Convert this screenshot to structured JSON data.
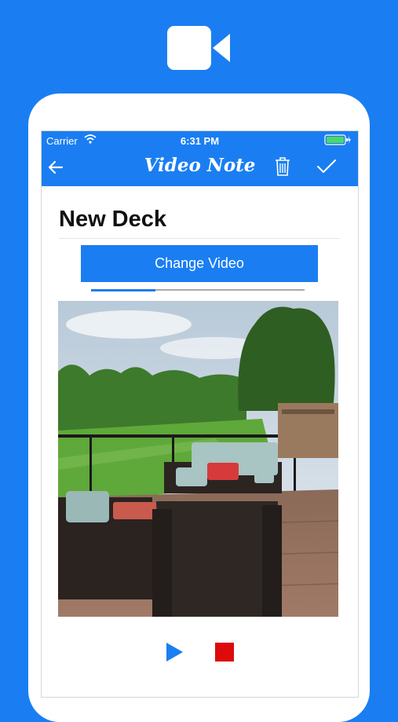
{
  "header": {
    "carrier": "Carrier",
    "time": "6:31 PM",
    "title": "Video Note"
  },
  "note": {
    "title": "New Deck",
    "change_video_label": "Change Video",
    "playback_progress": 0.3
  },
  "colors": {
    "brand_blue": "#1a7ef2",
    "stop_red": "#dd0b0b",
    "battery_green": "#4cd964"
  },
  "icons": {
    "top": "video-camera-icon",
    "back": "back-arrow-icon",
    "delete": "trash-icon",
    "done": "checkmark-icon",
    "play": "play-icon",
    "stop": "stop-icon"
  }
}
